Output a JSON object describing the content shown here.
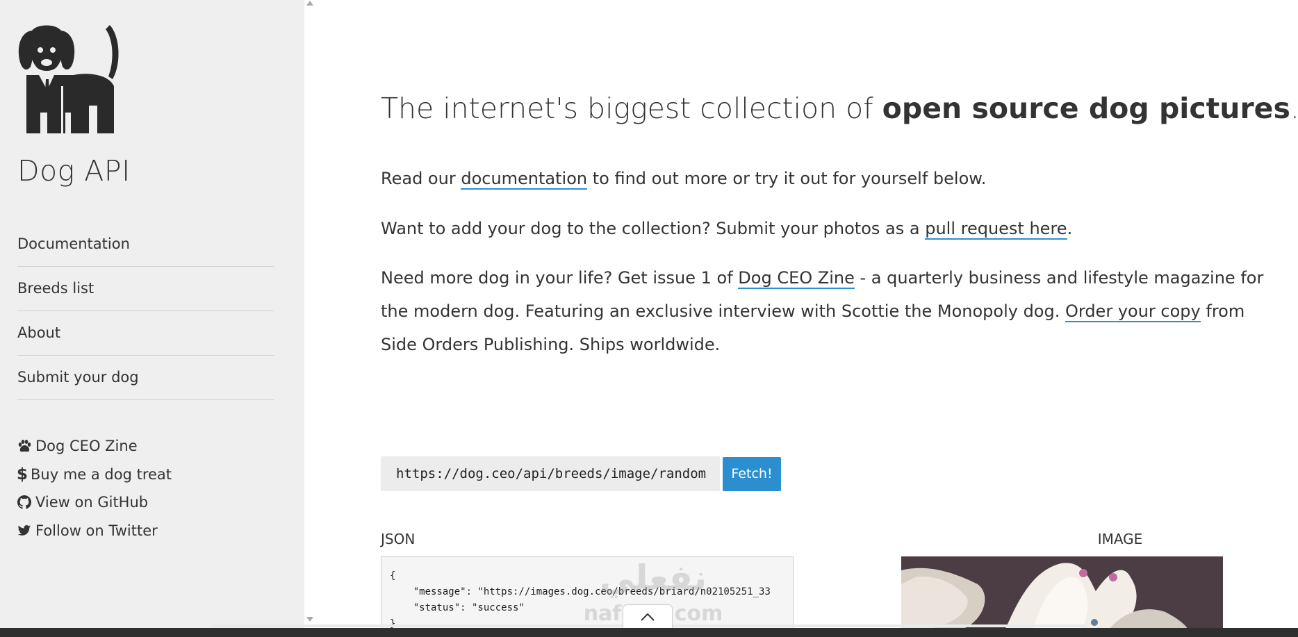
{
  "sidebar": {
    "site_title": "Dog API",
    "nav_items": [
      {
        "label": "Documentation"
      },
      {
        "label": "Breeds list"
      },
      {
        "label": "About"
      },
      {
        "label": "Submit your dog"
      }
    ],
    "external_links": [
      {
        "icon": "paw-icon",
        "label": "Dog CEO Zine"
      },
      {
        "icon": "dollar-icon",
        "label": "Buy me a dog treat"
      },
      {
        "icon": "github-icon",
        "label": "View on GitHub"
      },
      {
        "icon": "twitter-icon",
        "label": "Follow on Twitter"
      }
    ]
  },
  "main": {
    "headline_light": "The internet's biggest collection of ",
    "headline_bold": "open source dog pictures",
    "headline_end": ".",
    "p1": {
      "before": "Read our ",
      "link": "documentation",
      "after": " to find out more or try it out for yourself below."
    },
    "p2": {
      "before": "Want to add your dog to the collection? Submit your photos as a ",
      "link": "pull request here",
      "after": "."
    },
    "p3": {
      "before": "Need more dog in your life? Get issue 1 of ",
      "link1": "Dog CEO Zine",
      "middle": " - a quarterly business and lifestyle magazine for the modern dog. Featuring an exclusive interview with Scottie the Monopoly dog. ",
      "link2": "Order your copy",
      "after": " from Side Orders Publishing. Ships worldwide."
    },
    "fetch": {
      "url": "https://dog.ceo/api/breeds/image/random",
      "button_label": "Fetch!"
    },
    "json_label": "JSON",
    "image_label": "IMAGE",
    "json_output": "{\n    \"message\": \"https://images.dog.ceo/breeds/briard/n02105251_33\n    \"status\": \"success\"\n}"
  },
  "watermark": {
    "line1": "نفعلي",
    "line2": "nafeziy.com"
  },
  "colors": {
    "accent": "#2b8ecf",
    "sidebar_bg": "#efefef",
    "text": "#333333"
  }
}
